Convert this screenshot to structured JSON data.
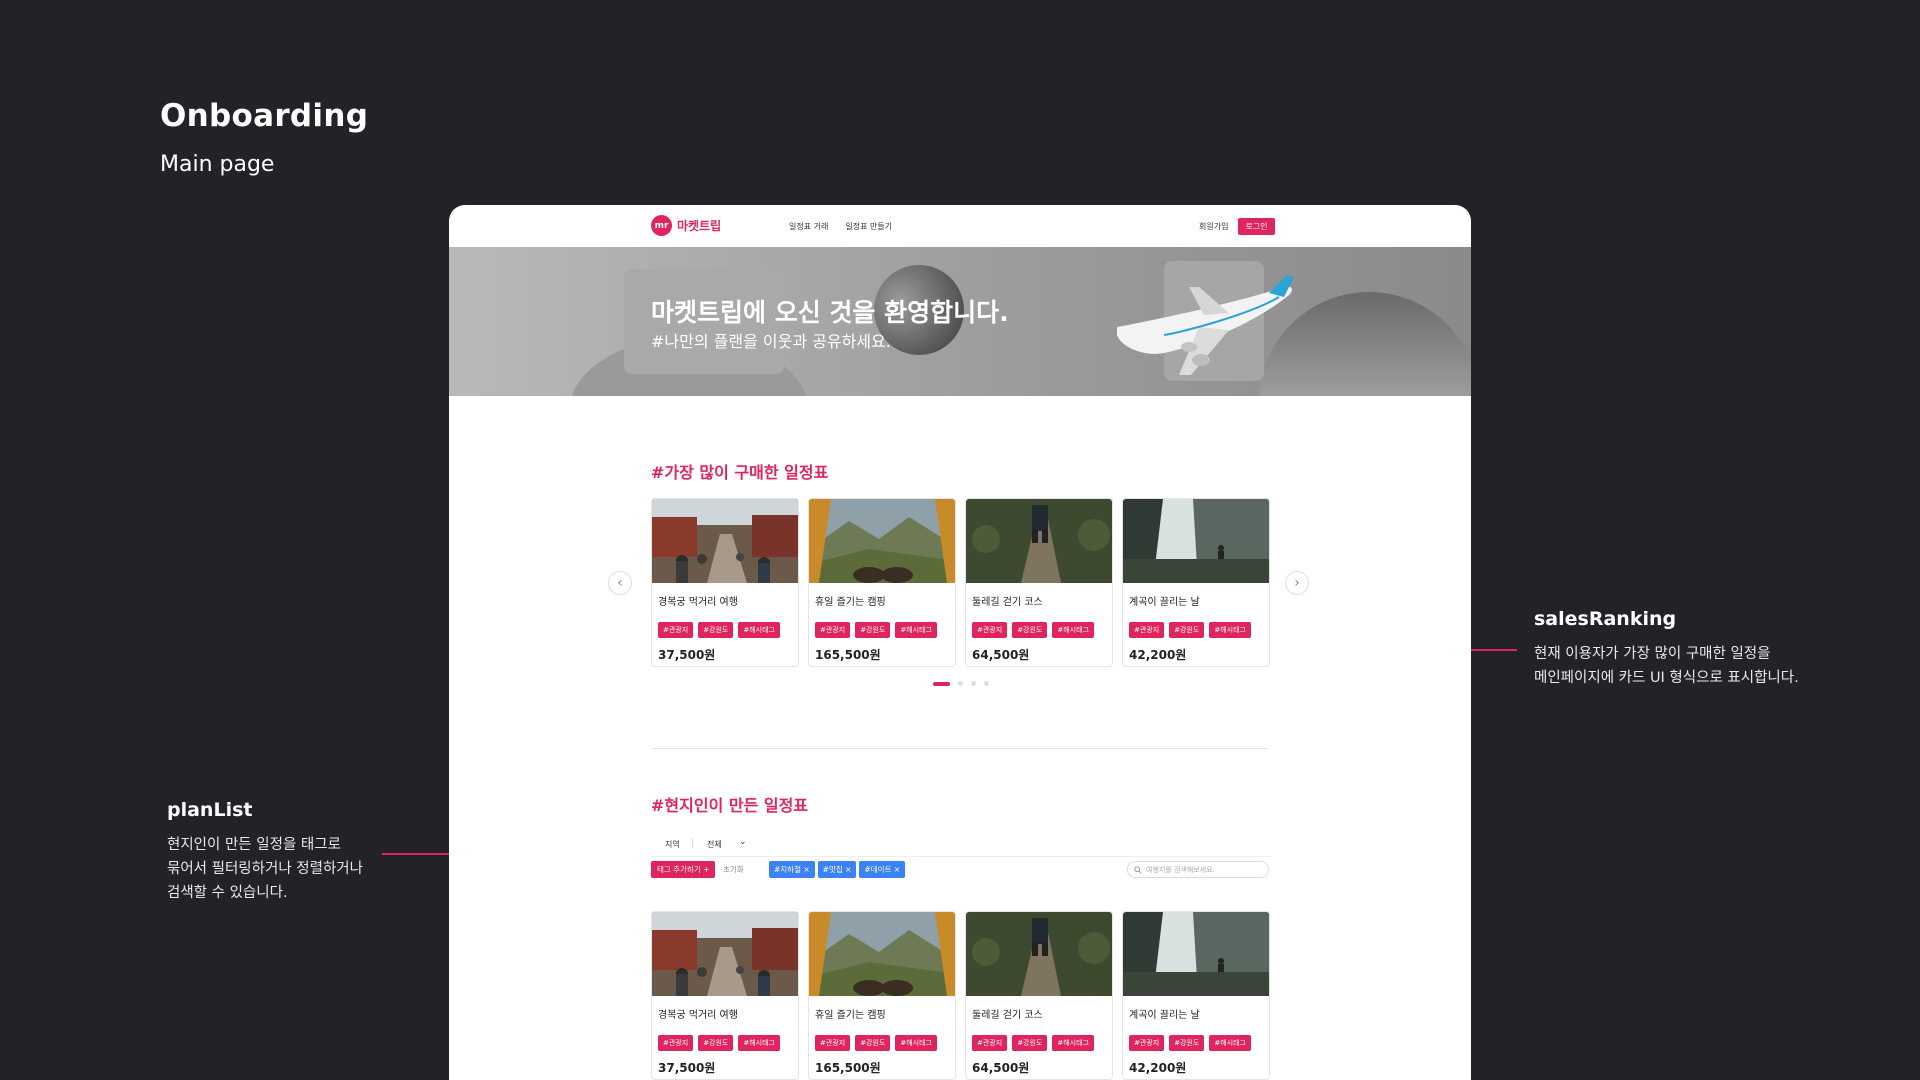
{
  "presentation": {
    "title": "Onboarding",
    "subtitle": "Main page"
  },
  "annotations": {
    "sales": {
      "title": "salesRanking",
      "desc": "현재 이용자가 가장 많이 구매한 일정을\n메인페이지에 카드 UI 형식으로 표시합니다."
    },
    "plan": {
      "title": "planList",
      "desc": "현지인이 만든 일정을 태그로\n묶어서 필터링하거나 정렬하거나\n검색할 수 있습니다."
    }
  },
  "site": {
    "logo_mark": "mr",
    "logo_text": "마켓트립",
    "nav": {
      "trade": "일정표 거래",
      "create": "일정표 만들기",
      "signup": "회원가입",
      "login": "로그인"
    },
    "hero": {
      "title": "마켓트립에 오신 것을 환영합니다.",
      "subtitle": "#나만의 플랜을 이웃과 공유하세요."
    },
    "ranking": {
      "title": "#가장 많이 구매한 일정표",
      "prev_icon": "chevron-left-icon",
      "next_icon": "chevron-right-icon",
      "prev_glyph": "‹",
      "next_glyph": "›",
      "cards": [
        {
          "title": "경복궁 먹거리 여행",
          "tags": [
            "#관광지",
            "#강원도",
            "#해시태그"
          ],
          "price": "37,500원"
        },
        {
          "title": "휴일 즐기는 캠핑",
          "tags": [
            "#관광지",
            "#강원도",
            "#해시태그"
          ],
          "price": "165,500원"
        },
        {
          "title": "둘레길 걷기 코스",
          "tags": [
            "#관광지",
            "#강원도",
            "#해시태그"
          ],
          "price": "64,500원"
        },
        {
          "title": "계곡이 끌리는 날",
          "tags": [
            "#관광지",
            "#강원도",
            "#해시태그"
          ],
          "price": "42,200원"
        }
      ]
    },
    "planlist": {
      "title": "#현지인이 만든 일정표",
      "filter_region": "지역",
      "filter_value": "전체",
      "chevron": "⌄",
      "add_tag": "태그 추가하기 +",
      "reset": "초기화",
      "chips": [
        "#지하철 ×",
        "#맛집 ×",
        "#데이트 ×"
      ],
      "search_placeholder": "여행지를 검색해보세요.",
      "cards": [
        {
          "title": "경복궁 먹거리 여행",
          "tags": [
            "#관광지",
            "#강원도",
            "#해시태그"
          ],
          "price": "37,500원"
        },
        {
          "title": "휴일 즐기는 캠핑",
          "tags": [
            "#관광지",
            "#강원도",
            "#해시태그"
          ],
          "price": "165,500원"
        },
        {
          "title": "둘레길 걷기 코스",
          "tags": [
            "#관광지",
            "#강원도",
            "#해시태그"
          ],
          "price": "64,500원"
        },
        {
          "title": "계곡이 끌리는 날",
          "tags": [
            "#관광지",
            "#강원도",
            "#해시태그"
          ],
          "price": "42,200원"
        }
      ]
    }
  },
  "colors": {
    "accent": "#e0245e",
    "chip_blue": "#3b82f6",
    "background": "#222228"
  }
}
